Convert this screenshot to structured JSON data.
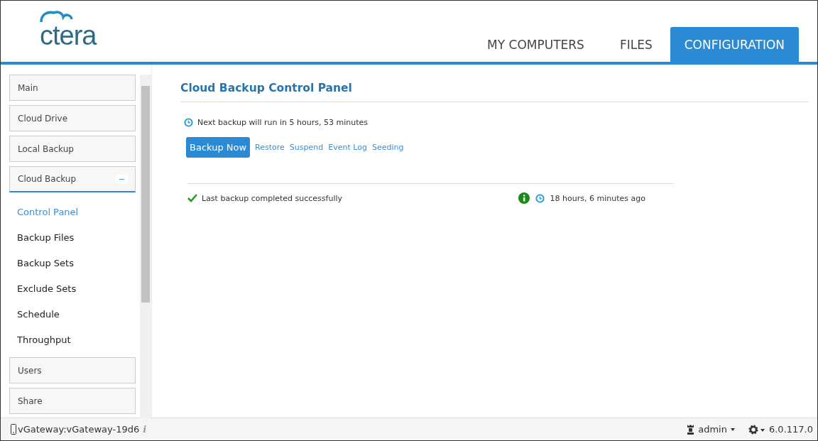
{
  "logo": {
    "text": "ctera"
  },
  "tabs": [
    {
      "label": "MY COMPUTERS",
      "selected": false
    },
    {
      "label": "FILES",
      "selected": false
    },
    {
      "label": "CONFIGURATION",
      "selected": true
    }
  ],
  "sidebar": {
    "items": [
      {
        "label": "Main",
        "expanded": false
      },
      {
        "label": "Cloud Drive",
        "expanded": false
      },
      {
        "label": "Local Backup",
        "expanded": false
      },
      {
        "label": "Cloud Backup",
        "expanded": true,
        "toggle": "−",
        "children": [
          {
            "label": "Control Panel",
            "selected": true
          },
          {
            "label": "Backup Files",
            "selected": false
          },
          {
            "label": "Backup Sets",
            "selected": false
          },
          {
            "label": "Exclude Sets",
            "selected": false
          },
          {
            "label": "Schedule",
            "selected": false
          },
          {
            "label": "Throughput",
            "selected": false
          }
        ]
      },
      {
        "label": "Users",
        "expanded": false
      },
      {
        "label": "Share",
        "expanded": false
      }
    ]
  },
  "panel": {
    "title": "Cloud Backup Control Panel",
    "next_backup": "Next backup will run in 5 hours, 53 minutes",
    "primary_button": "Backup Now",
    "links": [
      "Restore",
      "Suspend",
      "Event Log",
      "Seeding"
    ],
    "last_status": {
      "message": "Last backup completed successfully",
      "time": "18 hours, 6 minutes ago"
    }
  },
  "status_bar": {
    "device": "vGateway:vGateway-19d6",
    "info": "i",
    "user": "admin",
    "version": "6.0.117.0"
  }
}
